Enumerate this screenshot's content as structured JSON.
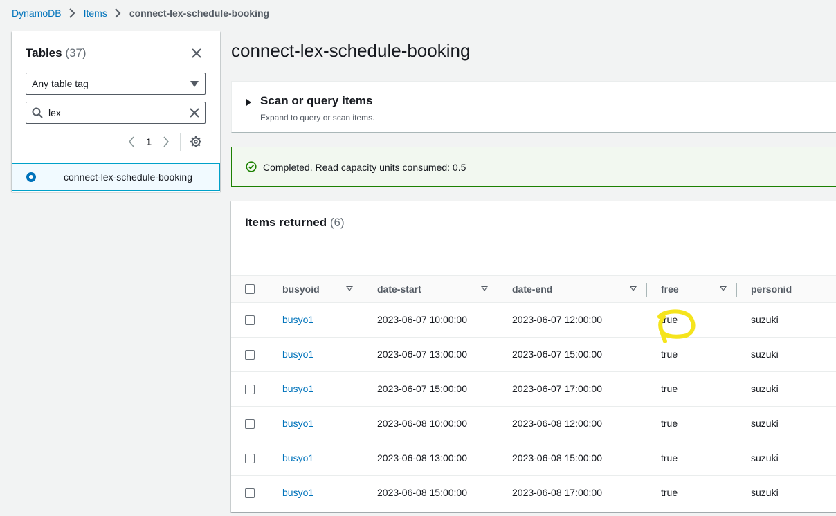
{
  "breadcrumb": {
    "items": [
      "DynamoDB",
      "Items"
    ],
    "current": "connect-lex-schedule-booking"
  },
  "sidebar": {
    "title": "Tables",
    "count": "(37)",
    "tag_filter": "Any table tag",
    "search_value": "lex",
    "page": "1",
    "selected_table": "connect-lex-schedule-booking"
  },
  "main": {
    "title": "connect-lex-schedule-booking",
    "scan": {
      "title": "Scan or query items",
      "description": "Expand to query or scan items."
    },
    "alert": {
      "message": "Completed. Read capacity units consumed: 0.5"
    },
    "items": {
      "title": "Items returned",
      "count": "(6)",
      "columns": [
        "busyoid",
        "date-start",
        "date-end",
        "free",
        "personid"
      ],
      "rows": [
        {
          "busyoid": "busyo1",
          "date_start": "2023-06-07 10:00:00",
          "date_end": "2023-06-07 12:00:00",
          "free": "true",
          "personid": "suzuki"
        },
        {
          "busyoid": "busyo1",
          "date_start": "2023-06-07 13:00:00",
          "date_end": "2023-06-07 15:00:00",
          "free": "true",
          "personid": "suzuki"
        },
        {
          "busyoid": "busyo1",
          "date_start": "2023-06-07 15:00:00",
          "date_end": "2023-06-07 17:00:00",
          "free": "true",
          "personid": "suzuki"
        },
        {
          "busyoid": "busyo1",
          "date_start": "2023-06-08 10:00:00",
          "date_end": "2023-06-08 12:00:00",
          "free": "true",
          "personid": "suzuki"
        },
        {
          "busyoid": "busyo1",
          "date_start": "2023-06-08 13:00:00",
          "date_end": "2023-06-08 15:00:00",
          "free": "true",
          "personid": "suzuki"
        },
        {
          "busyoid": "busyo1",
          "date_start": "2023-06-08 15:00:00",
          "date_end": "2023-06-08 17:00:00",
          "free": "true",
          "personid": "suzuki"
        }
      ]
    }
  },
  "colors": {
    "link": "#0073bb",
    "success": "#1d8102",
    "highlight": "#f5e41c"
  },
  "icons": [
    "chevron-right-icon",
    "close-icon",
    "caret-down-icon",
    "search-icon",
    "chevron-left-icon",
    "gear-icon",
    "check-circle-icon",
    "triangle-right-icon",
    "sort-icon"
  ]
}
